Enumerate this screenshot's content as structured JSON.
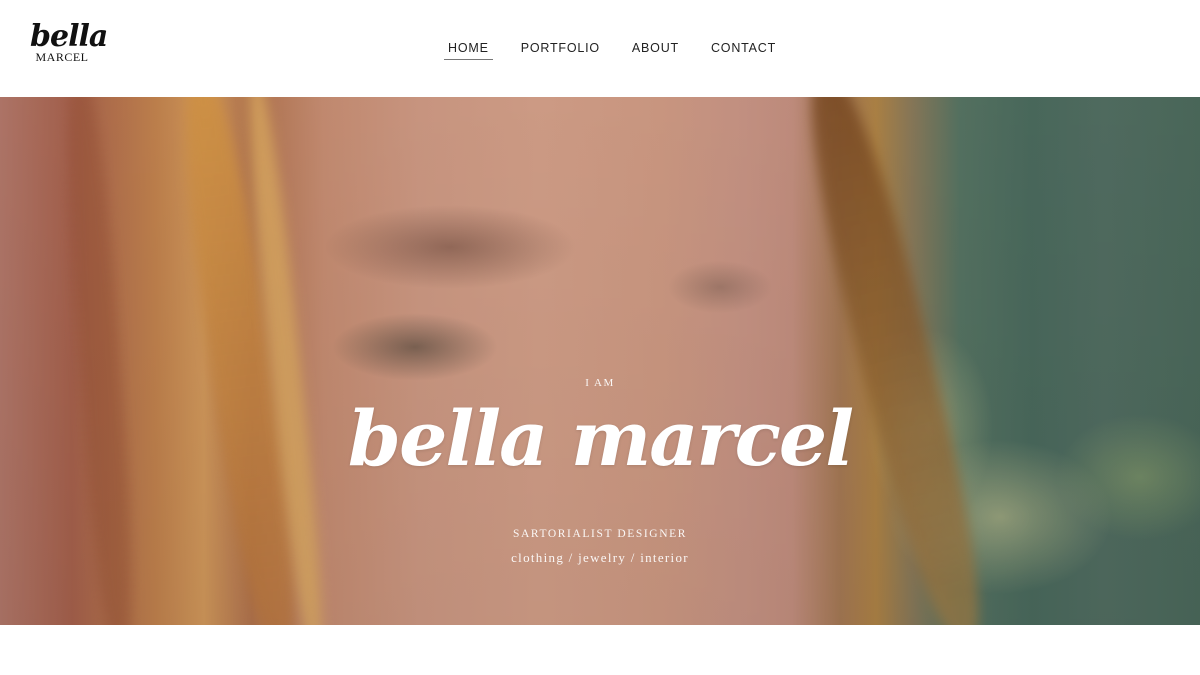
{
  "header": {
    "logo": {
      "script": "bella",
      "sub": "MARCEL"
    },
    "nav": [
      {
        "label": "HOME",
        "active": true
      },
      {
        "label": "PORTFOLIO",
        "active": false
      },
      {
        "label": "ABOUT",
        "active": false
      },
      {
        "label": "CONTACT",
        "active": false
      }
    ]
  },
  "hero": {
    "eyebrow": "I AM",
    "name": "bella marcel",
    "role": "SARTORIALIST DESIGNER",
    "tags": "clothing / jewelry / interior",
    "image_description": "close-up portrait of a woman's eye with auburn hair, blurred green bokeh background"
  }
}
